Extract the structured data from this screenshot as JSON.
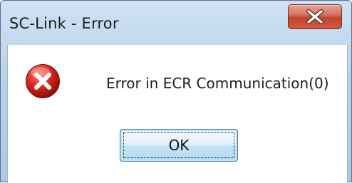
{
  "window": {
    "title": "SC-Link - Error",
    "close_icon": "close-icon"
  },
  "dialog": {
    "icon": "error-icon",
    "message": "Error in ECR Communication(0)",
    "ok_label": "OK"
  },
  "colors": {
    "close_button": "#c2432d",
    "error_icon": "#d9241c",
    "ok_button_border": "#3c7fb1"
  }
}
